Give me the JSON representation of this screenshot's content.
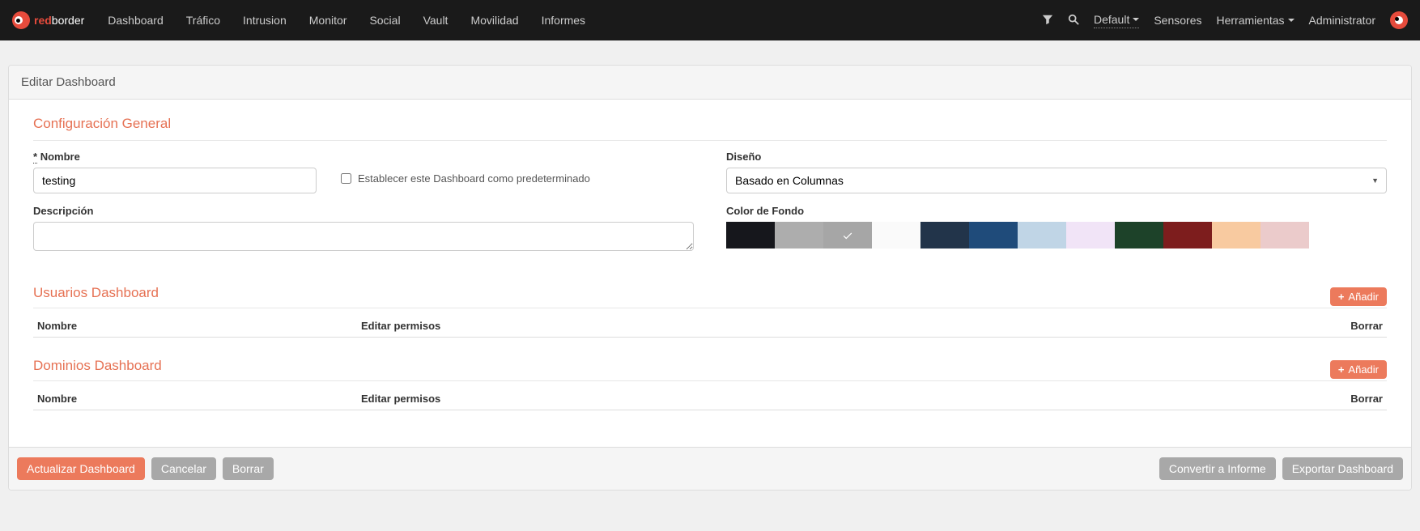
{
  "nav": {
    "brand_red": "red",
    "brand_rest": "border",
    "items": [
      "Dashboard",
      "Tráfico",
      "Intrusion",
      "Monitor",
      "Social",
      "Vault",
      "Movilidad",
      "Informes"
    ],
    "default_label": "Default",
    "sensores": "Sensores",
    "herramientas": "Herramientas",
    "admin": "Administrator"
  },
  "panel": {
    "title": "Editar Dashboard"
  },
  "general": {
    "heading": "Configuración General",
    "name_label": "Nombre",
    "name_value": "testing",
    "default_checkbox": "Establecer este Dashboard como predeterminado",
    "desc_label": "Descripción",
    "desc_value": "",
    "layout_label": "Diseño",
    "layout_value": "Basado en Columnas",
    "bg_label": "Color de Fondo",
    "colors": [
      "#16171c",
      "#adadad",
      "#a6a6a6",
      "#fafafa",
      "#22344a",
      "#1f4b7a",
      "#c0d5e6",
      "#f1e4f7",
      "#1d4229",
      "#7d1d1d",
      "#f8caa0",
      "#ebcbcb"
    ],
    "selected_color_index": 2
  },
  "users": {
    "heading": "Usuarios Dashboard",
    "add": "Añadir",
    "th_name": "Nombre",
    "th_perm": "Editar permisos",
    "th_del": "Borrar"
  },
  "domains": {
    "heading": "Dominios Dashboard",
    "add": "Añadir",
    "th_name": "Nombre",
    "th_perm": "Editar permisos",
    "th_del": "Borrar"
  },
  "footer": {
    "update": "Actualizar Dashboard",
    "cancel": "Cancelar",
    "delete": "Borrar",
    "convert": "Convertir a Informe",
    "export": "Exportar Dashboard"
  }
}
